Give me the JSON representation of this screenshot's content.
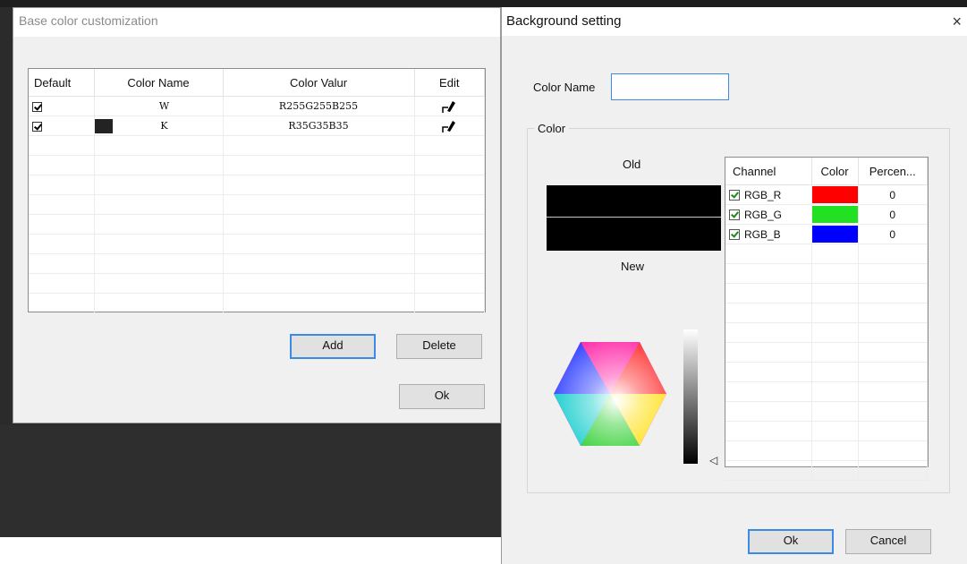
{
  "left_dialog": {
    "title": "Base color customization",
    "columns": [
      "Default",
      "Color Name",
      "Color Valur",
      "Edit"
    ],
    "rows": [
      {
        "default_checked": true,
        "swatch": "",
        "name": "W",
        "value": "R255G255B255"
      },
      {
        "default_checked": true,
        "swatch": "#232323",
        "name": "K",
        "value": "R35G35B35"
      }
    ],
    "add_label": "Add",
    "delete_label": "Delete",
    "ok_label": "Ok"
  },
  "right_dialog": {
    "title": "Background setting",
    "close_glyph": "×",
    "color_name_label": "Color Name",
    "color_name_value": "",
    "color_group_label": "Color",
    "old_label": "Old",
    "new_label": "New",
    "channel_columns": [
      "Channel",
      "Color",
      "Percen..."
    ],
    "channels": [
      {
        "name": "RGB_R",
        "color": "#ff0000",
        "percent": "0",
        "checked": true
      },
      {
        "name": "RGB_G",
        "color": "#22e022",
        "percent": "0",
        "checked": true
      },
      {
        "name": "RGB_B",
        "color": "#0000ff",
        "percent": "0",
        "checked": true
      }
    ],
    "ok_label": "Ok",
    "cancel_label": "Cancel",
    "slider_pointer_glyph": "◁"
  }
}
